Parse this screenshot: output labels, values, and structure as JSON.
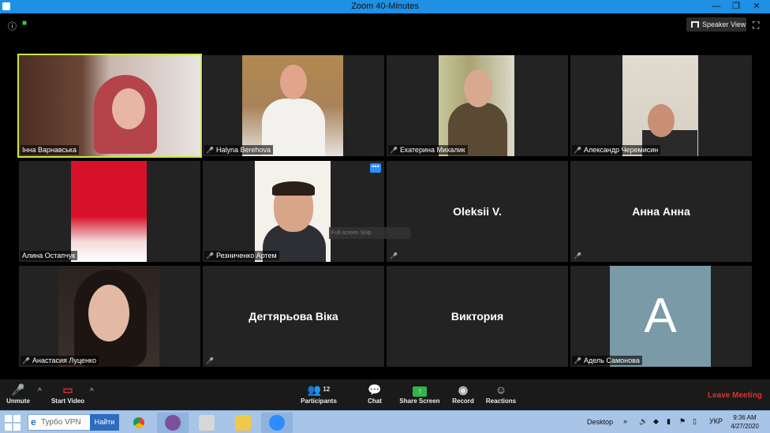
{
  "window": {
    "title": "Zoom 40-Minutes",
    "minimize": "—",
    "restore": "❐",
    "close": "✕"
  },
  "top": {
    "info_icon": "ⓘ",
    "lock_icon": "🔒",
    "speaker_view": "Speaker View",
    "fullscreen_icon": "⛶"
  },
  "participants": [
    {
      "name": "Інна Варнавська",
      "muted": false,
      "active": true
    },
    {
      "name": "Halyna Berehova",
      "muted": true
    },
    {
      "name": "Екатерина Михалик",
      "muted": true
    },
    {
      "name": "Александр Черемисин",
      "muted": true
    },
    {
      "name": "Алина Остапчук",
      "muted": false
    },
    {
      "name": "Резниченко Артем",
      "muted": true
    },
    {
      "display": "Oleksii V.",
      "muted": true
    },
    {
      "display": "Анна Анна",
      "muted": true
    },
    {
      "name": "Анастасия Луценко",
      "muted": true
    },
    {
      "display": "Дегтярьова Віка",
      "muted": true
    },
    {
      "display": "Виктория",
      "muted": false
    },
    {
      "name": "Адель Самонова",
      "muted": true,
      "avatar_letter": "A"
    }
  ],
  "more_button": "•••",
  "snip_tooltip": "Full-screen Snip",
  "toolbar": {
    "unmute": "Unmute",
    "start_video": "Start Video",
    "participants": "Participants",
    "participants_count": "12",
    "chat": "Chat",
    "share_screen": "Share Screen",
    "record": "Record",
    "reactions": "Reactions",
    "leave": "Leave Meeting"
  },
  "taskbar": {
    "vpn_text": "Турбо VPN",
    "vpn_button": "Найти",
    "desktop": "Desktop",
    "lang": "УКР",
    "time": "9:36 AM",
    "date": "4/27/2020"
  },
  "colors": {
    "active_border": "#c8e64b",
    "leave": "#e0302a",
    "accent": "#2d8cff"
  }
}
